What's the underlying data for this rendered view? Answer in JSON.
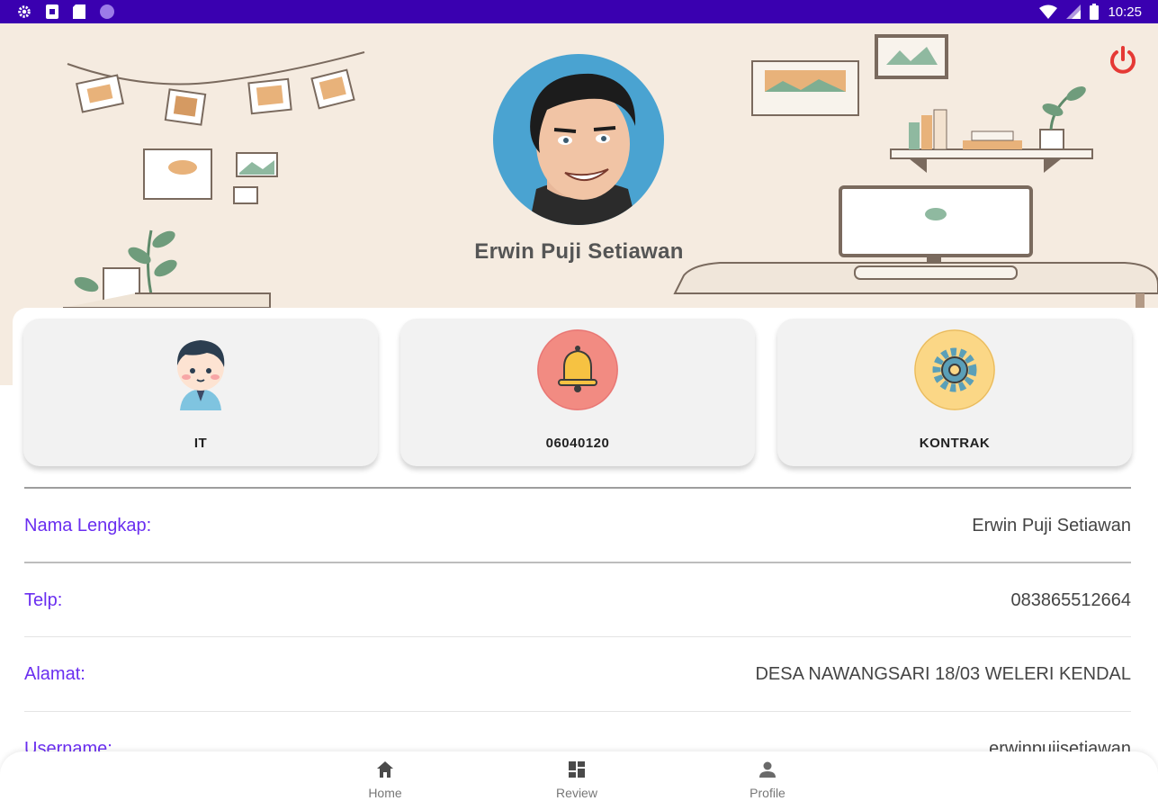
{
  "status_bar": {
    "time": "10:25",
    "icons": [
      "gear-icon",
      "sim-icon",
      "sd-card-icon",
      "circle-icon",
      "wifi-icon",
      "signal-icon",
      "battery-icon"
    ]
  },
  "profile": {
    "name": "Erwin Puji Setiawan",
    "avatar_color": "#4aa3d1",
    "logout_icon": "power-icon",
    "logout_color": "#e53935"
  },
  "cards": [
    {
      "icon": "boy-avatar-icon",
      "label": "IT",
      "icon_bg": "#f2f2f2"
    },
    {
      "icon": "bell-icon",
      "label": "06040120",
      "icon_bg": "#f28b82"
    },
    {
      "icon": "gear-icon",
      "label": "KONTRAK",
      "icon_bg": "#fbd786"
    }
  ],
  "info_rows": [
    {
      "label": "Nama Lengkap:",
      "value": "Erwin Puji Setiawan"
    },
    {
      "label": "Telp:",
      "value": "083865512664"
    },
    {
      "label": "Alamat:",
      "value": "DESA NAWANGSARI 18/03 WELERI KENDAL"
    },
    {
      "label": "Username:",
      "value": "erwinpujisetiawan"
    }
  ],
  "bottom_nav": [
    {
      "icon": "home-icon",
      "label": "Home"
    },
    {
      "icon": "grid-icon",
      "label": "Review"
    },
    {
      "icon": "person-icon",
      "label": "Profile"
    }
  ],
  "colors": {
    "status_bar": "#3a00b0",
    "header_bg": "#f5ebe0",
    "label_accent": "#6a2ef0"
  }
}
